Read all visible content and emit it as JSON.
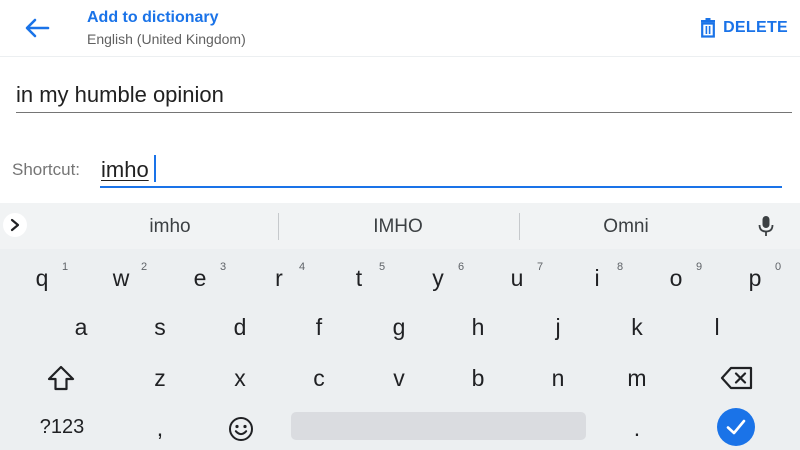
{
  "header": {
    "title": "Add to dictionary",
    "subtitle": "English (United Kingdom)",
    "delete_label": "DELETE"
  },
  "form": {
    "phrase_value": "in my humble opinion",
    "shortcut_label": "Shortcut:",
    "shortcut_value": "imho"
  },
  "suggestions": [
    "imho",
    "IMHO",
    "Omni"
  ],
  "keyboard": {
    "row1": [
      {
        "k": "q",
        "h": "1"
      },
      {
        "k": "w",
        "h": "2"
      },
      {
        "k": "e",
        "h": "3"
      },
      {
        "k": "r",
        "h": "4"
      },
      {
        "k": "t",
        "h": "5"
      },
      {
        "k": "y",
        "h": "6"
      },
      {
        "k": "u",
        "h": "7"
      },
      {
        "k": "i",
        "h": "8"
      },
      {
        "k": "o",
        "h": "9"
      },
      {
        "k": "p",
        "h": "0"
      }
    ],
    "row2": [
      "a",
      "s",
      "d",
      "f",
      "g",
      "h",
      "j",
      "k",
      "l"
    ],
    "row3": [
      "z",
      "x",
      "c",
      "v",
      "b",
      "n",
      "m"
    ],
    "symbols_label": "?123",
    "comma": ",",
    "period": "."
  },
  "colors": {
    "accent": "#1a73e8",
    "keyboard_bg": "#eceff1"
  },
  "icons": [
    "back-arrow-icon",
    "trash-icon",
    "chevron-right-icon",
    "mic-icon",
    "shift-icon",
    "backspace-icon",
    "emoji-icon",
    "checkmark-icon"
  ]
}
